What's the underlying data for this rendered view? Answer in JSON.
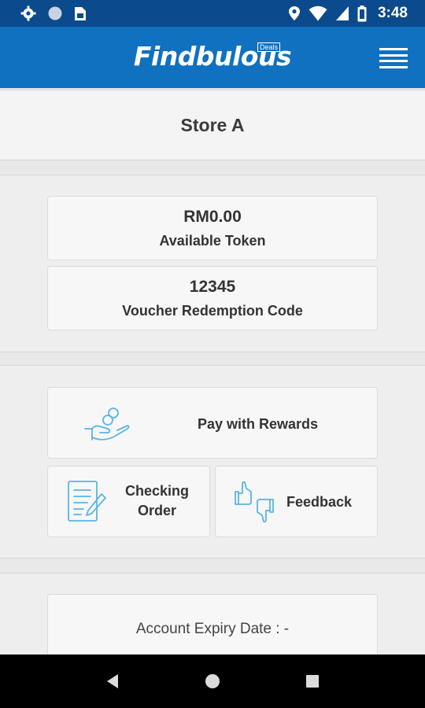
{
  "status_bar": {
    "time": "3:48",
    "icons": [
      "gear-icon",
      "circle-icon",
      "sim-card-icon",
      "location-icon",
      "wifi-icon",
      "signal-icon",
      "battery-icon"
    ]
  },
  "app_bar": {
    "logo_text": "Findbulous",
    "logo_sub": "Deals",
    "menu_icon": "hamburger-menu-icon"
  },
  "store": {
    "name": "Store A"
  },
  "token": {
    "value": "RM0.00",
    "label": "Available Token"
  },
  "voucher": {
    "value": "12345",
    "label": "Voucher Redemption Code"
  },
  "actions": {
    "pay": {
      "label": "Pay with Rewards",
      "icon": "hand-coins-icon"
    },
    "checking": {
      "label_line1": "Checking",
      "label_line2": "Order",
      "icon": "document-pen-icon"
    },
    "feedback": {
      "label": "Feedback",
      "icon": "thumbs-up-down-icon"
    }
  },
  "account": {
    "expiry": "Account Expiry Date : -"
  },
  "colors": {
    "status_bar": "#0b4a8c",
    "app_bar": "#1071c0",
    "icon_accent": "#5ab4e5"
  },
  "nav_bar": {
    "icons": [
      "back-icon",
      "home-icon",
      "recents-icon"
    ]
  }
}
